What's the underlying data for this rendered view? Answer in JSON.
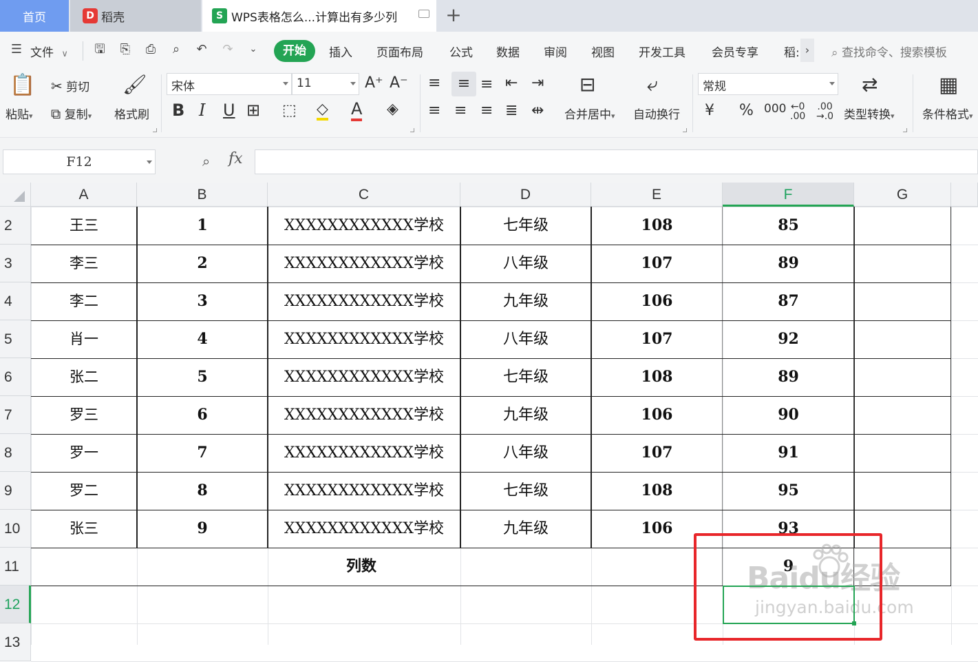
{
  "tabs": {
    "home": "首页",
    "daoke": "稻壳",
    "doc": "WPS表格怎么...计算出有多少列",
    "add": "+"
  },
  "menu": {
    "file": "文件",
    "start": "开始",
    "items": [
      "插入",
      "页面布局",
      "公式",
      "数据",
      "审阅",
      "视图",
      "开发工具",
      "会员专享",
      "稻:"
    ],
    "search": "查找命令、搜索模板"
  },
  "ribbon": {
    "paste": "粘贴",
    "cut": "剪切",
    "copy": "复制",
    "format_painter": "格式刷",
    "font_name": "宋体",
    "font_size": "11",
    "merge_center": "合并居中",
    "wrap_text": "自动换行",
    "number_format": "常规",
    "type_convert": "类型转换",
    "cond_format": "条件格式"
  },
  "formula": {
    "cell_ref": "F12",
    "fx": "fx",
    "value": ""
  },
  "sheet": {
    "columns": [
      "A",
      "B",
      "C",
      "D",
      "E",
      "F",
      "G"
    ],
    "active_column": "F",
    "rows": [
      "2",
      "3",
      "4",
      "5",
      "6",
      "7",
      "8",
      "9",
      "10",
      "11",
      "12",
      "13"
    ],
    "active_row": "12",
    "data": [
      {
        "name": "王三",
        "num": "1",
        "school": "XXXXXXXXXXXX学校",
        "grade": "七年级",
        "e": "108",
        "f": "85"
      },
      {
        "name": "李三",
        "num": "2",
        "school": "XXXXXXXXXXXX学校",
        "grade": "八年级",
        "e": "107",
        "f": "89"
      },
      {
        "name": "李二",
        "num": "3",
        "school": "XXXXXXXXXXXX学校",
        "grade": "九年级",
        "e": "106",
        "f": "87"
      },
      {
        "name": "肖一",
        "num": "4",
        "school": "XXXXXXXXXXXX学校",
        "grade": "八年级",
        "e": "107",
        "f": "92"
      },
      {
        "name": "张二",
        "num": "5",
        "school": "XXXXXXXXXXXX学校",
        "grade": "七年级",
        "e": "108",
        "f": "89"
      },
      {
        "name": "罗三",
        "num": "6",
        "school": "XXXXXXXXXXXX学校",
        "grade": "九年级",
        "e": "106",
        "f": "90"
      },
      {
        "name": "罗一",
        "num": "7",
        "school": "XXXXXXXXXXXX学校",
        "grade": "八年级",
        "e": "107",
        "f": "91"
      },
      {
        "name": "罗二",
        "num": "8",
        "school": "XXXXXXXXXXXX学校",
        "grade": "七年级",
        "e": "108",
        "f": "95"
      },
      {
        "name": "张三",
        "num": "9",
        "school": "XXXXXXXXXXXX学校",
        "grade": "九年级",
        "e": "106",
        "f": "93"
      }
    ],
    "summary_label": "列数",
    "summary_value": "9"
  },
  "watermark": {
    "brand": "Baidu经验",
    "url": "jingyan.baidu.com"
  },
  "colors": {
    "accent": "#23a454",
    "highlight": "#e8262a"
  }
}
